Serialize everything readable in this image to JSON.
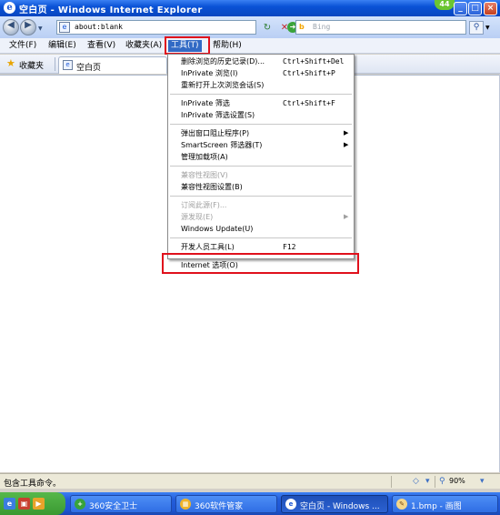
{
  "window": {
    "title": "空白页 - Windows Internet Explorer",
    "notification_count": "44",
    "icon": "ie-logo-icon"
  },
  "address_bar": {
    "url": "about:blank",
    "back_icon": "back-arrow-icon",
    "forward_icon": "forward-arrow-icon"
  },
  "search": {
    "placeholder": "Bing"
  },
  "menu": {
    "items": [
      {
        "label": "文件(F)"
      },
      {
        "label": "编辑(E)"
      },
      {
        "label": "查看(V)"
      },
      {
        "label": "收藏夹(A)"
      },
      {
        "label": "工具(T)"
      },
      {
        "label": "帮助(H)"
      }
    ],
    "active_index": 4
  },
  "favorites": {
    "label": "收藏夹",
    "tab_label": "空白页"
  },
  "tools_menu": {
    "items": [
      {
        "label": "删除浏览的历史记录(D)...",
        "shortcut": "Ctrl+Shift+Del",
        "arrow": ""
      },
      {
        "label": "InPrivate 浏览(I)",
        "shortcut": "Ctrl+Shift+P",
        "arrow": ""
      },
      {
        "label": "重新打开上次浏览会话(S)",
        "shortcut": "",
        "arrow": ""
      },
      {
        "label": "InPrivate 筛选",
        "shortcut": "Ctrl+Shift+F",
        "arrow": ""
      },
      {
        "label": "InPrivate 筛选设置(S)",
        "shortcut": "",
        "arrow": ""
      },
      {
        "label": "弹出窗口阻止程序(P)",
        "shortcut": "",
        "arrow": "▶"
      },
      {
        "label": "SmartScreen 筛选器(T)",
        "shortcut": "",
        "arrow": "▶"
      },
      {
        "label": "管理加载项(A)",
        "shortcut": "",
        "arrow": ""
      },
      {
        "label": "兼容性视图(V)",
        "shortcut": "",
        "arrow": ""
      },
      {
        "label": "兼容性视图设置(B)",
        "shortcut": "",
        "arrow": ""
      },
      {
        "label": "订阅此源(F)...",
        "shortcut": "",
        "arrow": ""
      },
      {
        "label": "源发现(E)",
        "shortcut": "",
        "arrow": "▶"
      },
      {
        "label": "Windows Update(U)",
        "shortcut": "",
        "arrow": ""
      },
      {
        "label": "开发人员工具(L)",
        "shortcut": "F12",
        "arrow": ""
      },
      {
        "label": "Internet 选项(O)",
        "shortcut": "",
        "arrow": ""
      }
    ]
  },
  "status_bar": {
    "text": "包含工具命令。",
    "zoom": "90%"
  },
  "taskbar": {
    "tasks": [
      {
        "label": "360安全卫士"
      },
      {
        "label": "360软件管家"
      },
      {
        "label": "空白页 - Windows ..."
      },
      {
        "label": "1.bmp - 画图"
      }
    ]
  },
  "colors": {
    "highlight": "#e0101c",
    "menu_active": "#316ac5",
    "titlebar": "#0a52d6"
  }
}
